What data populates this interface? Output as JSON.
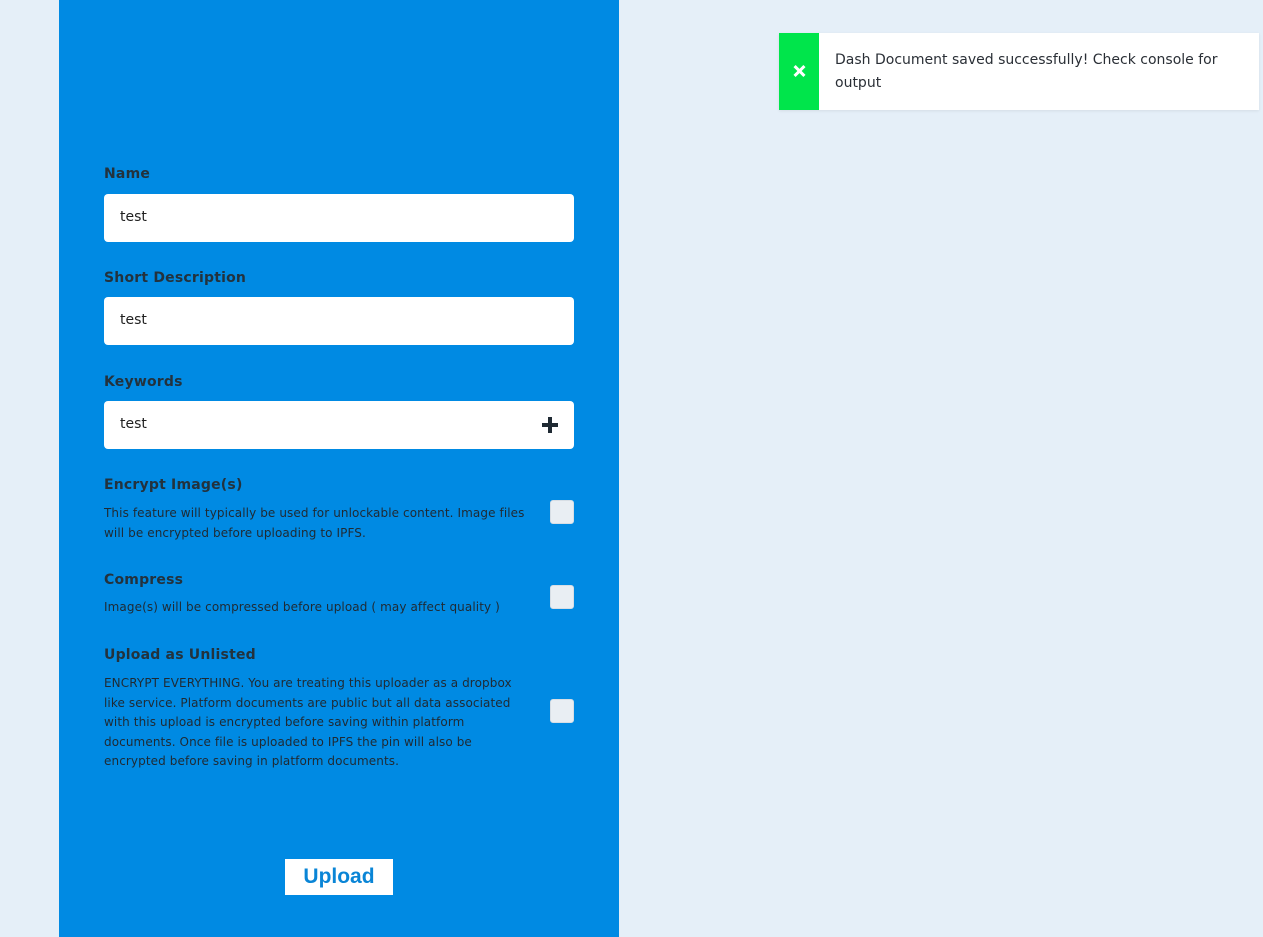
{
  "form": {
    "name": {
      "label": "Name",
      "value": "test"
    },
    "short_description": {
      "label": "Short Description",
      "value": "test"
    },
    "keywords": {
      "label": "Keywords",
      "value": "test"
    },
    "options": [
      {
        "title": "Encrypt Image(s)",
        "description": "This feature will typically be used for unlockable content. Image files will be encrypted before uploading to IPFS.",
        "checked": false
      },
      {
        "title": "Compress",
        "description": "Image(s) will be compressed before upload ( may affect quality )",
        "checked": false
      },
      {
        "title": "Upload as Unlisted",
        "description": "ENCRYPT EVERYTHING. You are treating this uploader as a dropbox like service. Platform documents are public but all data associated with this upload is encrypted before saving within platform documents. Once file is uploaded to IPFS the pin will also be encrypted before saving in platform documents.",
        "checked": false
      }
    ],
    "upload_label": "Upload"
  },
  "toast": {
    "message": "Dash Document saved successfully! Check console for output",
    "close_icon": "close-icon",
    "accent_color": "#00e54b"
  },
  "theme": {
    "panel_color": "#008ae3",
    "background_color": "#e5eff8"
  }
}
